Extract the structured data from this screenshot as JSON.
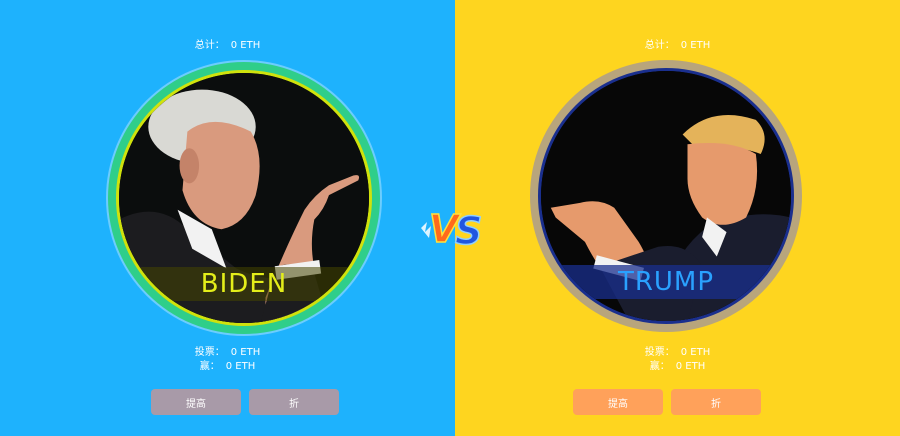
{
  "left": {
    "total_label": "总计：",
    "total_value": "0 ETH",
    "name": "BIDEN",
    "vote_label": "投票：",
    "vote_value": "0 ETH",
    "win_label": "赢：",
    "win_value": "0 ETH",
    "raise_button": "提高",
    "fold_button": "折",
    "colors": {
      "background": "#1eb2fd",
      "ring": "#2fce8a",
      "name": "#e4ee1a",
      "button": "#a89aa8"
    }
  },
  "right": {
    "total_label": "总计：",
    "total_value": "0 ETH",
    "name": "TRUMP",
    "vote_label": "投票：",
    "vote_value": "0 ETH",
    "win_label": "赢：",
    "win_value": "0 ETH",
    "raise_button": "提高",
    "fold_button": "折",
    "colors": {
      "background": "#fed51f",
      "ring": "#b8a57c",
      "name": "#2aa1ff",
      "button": "#ffa15a"
    }
  },
  "vs_text": "VS"
}
